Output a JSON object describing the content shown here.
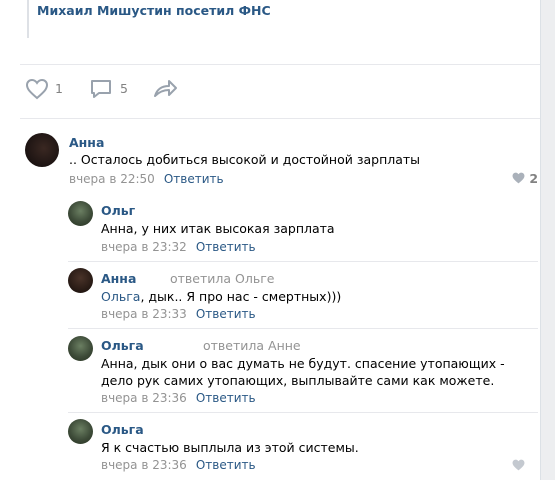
{
  "post": {
    "repost_title": "Михаил Мишустин посетил ФНС",
    "likes": "1",
    "comments": "5"
  },
  "comments": [
    {
      "author": "Анна",
      "reply_to": "",
      "addressee": "",
      "text": ".. Осталось добиться высокой и достойной зарплаты",
      "time": "вчера в 22:50",
      "reply_label": "Ответить",
      "likes": "2"
    },
    {
      "author": "Ольг",
      "reply_to": "",
      "addressee": "",
      "text": "Анна, у них итак высокая зарплата",
      "time": "вчера в 23:32",
      "reply_label": "Ответить",
      "likes": ""
    },
    {
      "author": "Анна",
      "reply_to": "ответила Ольге",
      "addressee": "Ольга",
      "text": ", дык.. Я про нас - смертных)))",
      "time": "вчера в 23:33",
      "reply_label": "Ответить",
      "likes": ""
    },
    {
      "author": "Ольга",
      "reply_to": "ответила Анне",
      "addressee": "",
      "text": "Анна, дык они о вас думать не будут. спасение утопающих - дело рук самих утопающих, выплывайте сами как можете.",
      "time": "вчера в 23:36",
      "reply_label": "Ответить",
      "likes": ""
    },
    {
      "author": "Ольга",
      "reply_to": "",
      "addressee": "",
      "text": "Я к счастью выплыла из этой системы.",
      "time": "вчера в 23:36",
      "reply_label": "Ответить",
      "likes": ""
    }
  ],
  "colors": {
    "link": "#2a5885",
    "muted": "#939393",
    "icon": "#99a2ad",
    "background": "#edeef0"
  },
  "icons": [
    "heart-icon",
    "comment-icon",
    "share-icon"
  ]
}
